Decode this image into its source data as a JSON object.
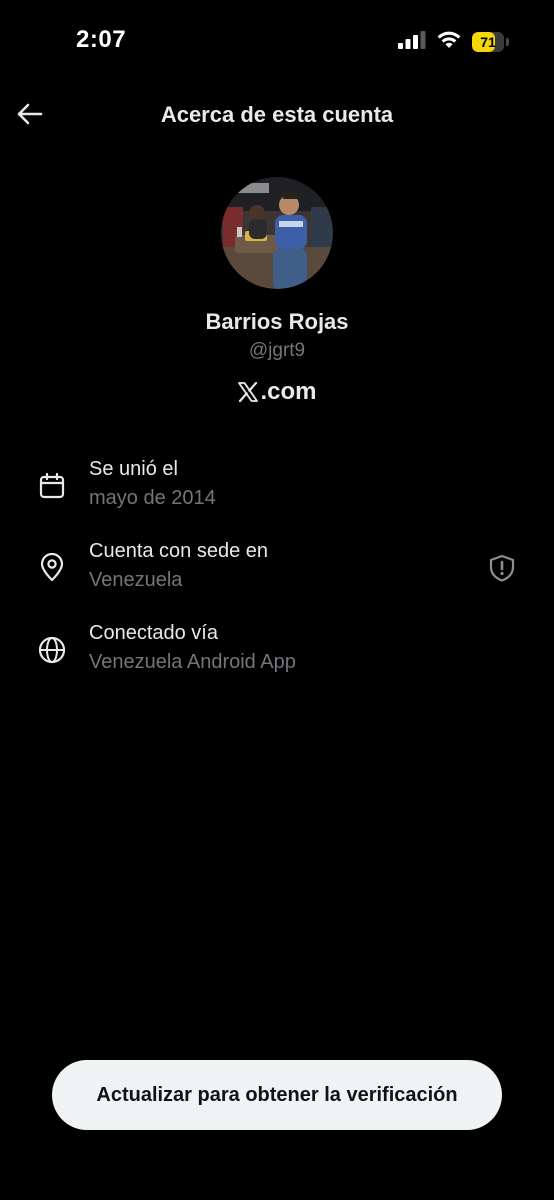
{
  "status_bar": {
    "time": "2:07",
    "battery_level": "71",
    "battery_fraction": 0.71,
    "battery_color": "#f5d60a"
  },
  "header": {
    "title": "Acerca de esta cuenta",
    "back_icon": "arrow-left-icon"
  },
  "profile": {
    "display_name": "Barrios Rojas",
    "handle": "@jgrt9",
    "site_label": ".com",
    "site_logo": "x-logo-icon"
  },
  "info": [
    {
      "icon": "calendar-icon",
      "label": "Se unió el",
      "value": "mayo de 2014"
    },
    {
      "icon": "location-pin-icon",
      "label": "Cuenta con sede en",
      "value": "Venezuela",
      "trailing_icon": "shield-icon"
    },
    {
      "icon": "globe-icon",
      "label": "Conectado vía",
      "value": "Venezuela Android App"
    }
  ],
  "cta": {
    "label": "Actualizar para obtener la verificación"
  },
  "colors": {
    "background": "#000000",
    "primary_text": "#e7e9ea",
    "secondary_text": "#71767b",
    "button_bg": "#eff3f4",
    "button_text": "#0f1419"
  }
}
